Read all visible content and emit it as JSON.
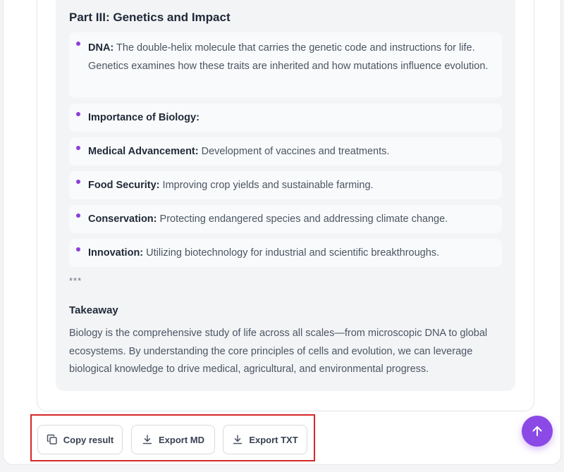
{
  "content": {
    "section_heading": "Part III: Genetics and Impact",
    "items": [
      {
        "term": "DNA:",
        "text": " The double-helix molecule that carries the genetic code and instructions for life. Genetics examines how these traits are inherited and how mutations influence evolution."
      },
      {
        "term": "Importance of Biology:",
        "text": ""
      },
      {
        "term": "Medical Advancement:",
        "text": " Development of vaccines and treatments."
      },
      {
        "term": "Food Security:",
        "text": " Improving crop yields and sustainable farming."
      },
      {
        "term": "Conservation:",
        "text": " Protecting endangered species and addressing climate change."
      },
      {
        "term": "Innovation:",
        "text": " Utilizing biotechnology for industrial and scientific breakthroughs."
      }
    ],
    "divider": "***",
    "takeaway_heading": "Takeaway",
    "takeaway_text": "Biology is the comprehensive study of life across all scales—from microscopic DNA to global ecosystems. By understanding the core principles of cells and evolution, we can leverage biological knowledge to drive medical, agricultural, and environmental progress."
  },
  "actions": {
    "copy_label": "Copy result",
    "export_md_label": "Export MD",
    "export_txt_label": "Export TXT"
  },
  "icons": {
    "copy": "copy-icon",
    "download": "download-icon",
    "scroll_top": "arrow-up-icon"
  },
  "colors": {
    "accent": "#8b49e6",
    "bullet": "#8b3fd9",
    "highlight_border": "#d62828"
  }
}
